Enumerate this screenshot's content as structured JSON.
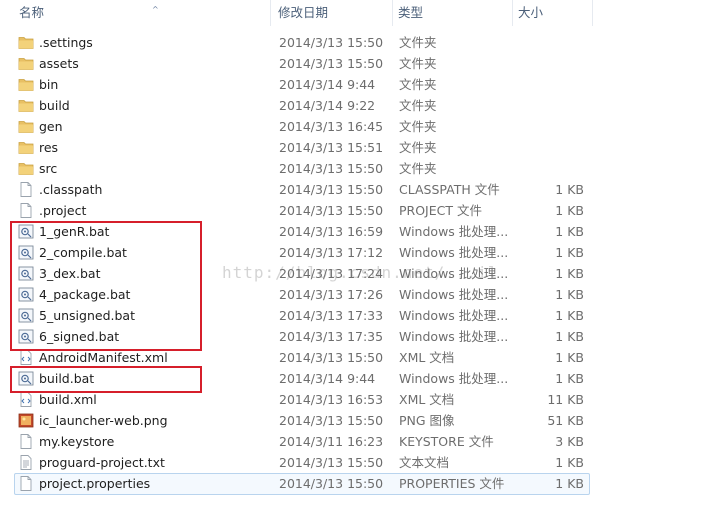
{
  "columns": {
    "name": "名称",
    "date": "修改日期",
    "type": "类型",
    "size": "大小"
  },
  "files": [
    {
      "name": ".settings",
      "date": "2014/3/13 15:50",
      "type": "文件夹",
      "size": "",
      "icon": "folder-icon"
    },
    {
      "name": "assets",
      "date": "2014/3/13 15:50",
      "type": "文件夹",
      "size": "",
      "icon": "folder-icon"
    },
    {
      "name": "bin",
      "date": "2014/3/14 9:44",
      "type": "文件夹",
      "size": "",
      "icon": "folder-icon"
    },
    {
      "name": "build",
      "date": "2014/3/14 9:22",
      "type": "文件夹",
      "size": "",
      "icon": "folder-icon"
    },
    {
      "name": "gen",
      "date": "2014/3/13 16:45",
      "type": "文件夹",
      "size": "",
      "icon": "folder-icon"
    },
    {
      "name": "res",
      "date": "2014/3/13 15:51",
      "type": "文件夹",
      "size": "",
      "icon": "folder-icon"
    },
    {
      "name": "src",
      "date": "2014/3/13 15:50",
      "type": "文件夹",
      "size": "",
      "icon": "folder-icon"
    },
    {
      "name": ".classpath",
      "date": "2014/3/13 15:50",
      "type": "CLASSPATH 文件",
      "size": "1 KB",
      "icon": "file-icon"
    },
    {
      "name": ".project",
      "date": "2014/3/13 15:50",
      "type": "PROJECT 文件",
      "size": "1 KB",
      "icon": "file-icon"
    },
    {
      "name": "1_genR.bat",
      "date": "2014/3/13 16:59",
      "type": "Windows 批处理...",
      "size": "1 KB",
      "icon": "batch-file-icon"
    },
    {
      "name": "2_compile.bat",
      "date": "2014/3/13 17:12",
      "type": "Windows 批处理...",
      "size": "1 KB",
      "icon": "batch-file-icon"
    },
    {
      "name": "3_dex.bat",
      "date": "2014/3/13 17:24",
      "type": "Windows 批处理...",
      "size": "1 KB",
      "icon": "batch-file-icon"
    },
    {
      "name": "4_package.bat",
      "date": "2014/3/13 17:26",
      "type": "Windows 批处理...",
      "size": "1 KB",
      "icon": "batch-file-icon"
    },
    {
      "name": "5_unsigned.bat",
      "date": "2014/3/13 17:33",
      "type": "Windows 批处理...",
      "size": "1 KB",
      "icon": "batch-file-icon"
    },
    {
      "name": "6_signed.bat",
      "date": "2014/3/13 17:35",
      "type": "Windows 批处理...",
      "size": "1 KB",
      "icon": "batch-file-icon"
    },
    {
      "name": "AndroidManifest.xml",
      "date": "2014/3/13 15:50",
      "type": "XML 文档",
      "size": "1 KB",
      "icon": "xml-file-icon"
    },
    {
      "name": "build.bat",
      "date": "2014/3/14 9:44",
      "type": "Windows 批处理...",
      "size": "1 KB",
      "icon": "batch-file-icon"
    },
    {
      "name": "build.xml",
      "date": "2014/3/13 16:53",
      "type": "XML 文档",
      "size": "11 KB",
      "icon": "xml-file-icon"
    },
    {
      "name": "ic_launcher-web.png",
      "date": "2014/3/13 15:50",
      "type": "PNG 图像",
      "size": "51 KB",
      "icon": "image-file-icon"
    },
    {
      "name": "my.keystore",
      "date": "2014/3/11 16:23",
      "type": "KEYSTORE 文件",
      "size": "3 KB",
      "icon": "file-icon"
    },
    {
      "name": "proguard-project.txt",
      "date": "2014/3/13 15:50",
      "type": "文本文档",
      "size": "1 KB",
      "icon": "text-file-icon"
    },
    {
      "name": "project.properties",
      "date": "2014/3/13 15:50",
      "type": "PROPERTIES 文件",
      "size": "1 KB",
      "icon": "file-icon",
      "selected": true
    }
  ],
  "watermark": "http://blog.csdn.net/...il",
  "colors": {
    "highlight_box": "#d61f2b",
    "folder": "#e8c064",
    "selection_border": "#b9d4ee"
  }
}
